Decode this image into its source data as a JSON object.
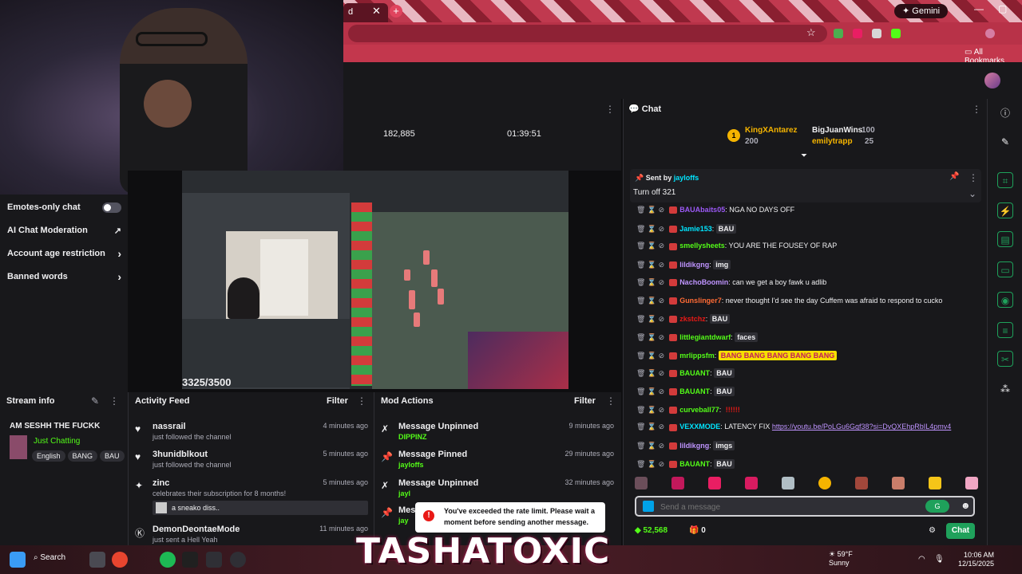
{
  "browser": {
    "tab_close": "✕",
    "new_tab": "+",
    "gemini_label": "Gemini",
    "all_bookmarks": "All Bookmarks"
  },
  "stats": {
    "viewers": "182,885",
    "uptime": "01:39:51"
  },
  "settings": {
    "items": [
      {
        "label": "Emotes-only chat",
        "control": "toggle"
      },
      {
        "label": "AI Chat Moderation",
        "control": "link"
      },
      {
        "label": "Account age restriction",
        "control": "arrow"
      },
      {
        "label": "Banned words",
        "control": "arrow"
      }
    ]
  },
  "video": {
    "counter": "3325/3500"
  },
  "stream_info": {
    "header": "Stream info",
    "title": "AM SESHH THE FUCKK",
    "category": "Just Chatting",
    "tags": [
      "English",
      "BANG",
      "BAU"
    ]
  },
  "activity_feed": {
    "header": "Activity Feed",
    "filter_label": "Filter",
    "items": [
      {
        "user": "nassrail",
        "text": "just followed the channel",
        "time": "4 minutes ago",
        "icon": "heart-icon"
      },
      {
        "user": "3hunidblkout",
        "text": "just followed the channel",
        "time": "5 minutes ago",
        "icon": "heart-icon"
      },
      {
        "user": "zinc",
        "text": "celebrates their subscription for 8 months!",
        "time": "5 minutes ago",
        "icon": "star-icon",
        "message": "a sneako diss.."
      },
      {
        "user": "DemonDeontaeMode",
        "text": "just sent a Hell Yeah",
        "time": "11 minutes ago",
        "icon": "kick-icon"
      }
    ]
  },
  "mod_actions": {
    "header": "Mod Actions",
    "filter_label": "Filter",
    "items": [
      {
        "action": "Message Unpinned",
        "by": "DIPPINZ",
        "time": "9 minutes ago"
      },
      {
        "action": "Message Pinned",
        "by": "jayloffs",
        "time": "29 minutes ago"
      },
      {
        "action": "Message Unpinned",
        "by": "jayl",
        "time": "32 minutes ago"
      },
      {
        "action": "Mes",
        "by": "jay",
        "time": ""
      }
    ]
  },
  "rate_limit": {
    "message": "You've exceeded the rate limit. Please wait a moment before sending another message."
  },
  "chat": {
    "header": "Chat",
    "leaderboard": [
      {
        "rank": "1",
        "user": "KingXAntarez",
        "amount": "200"
      },
      {
        "user": "BigJuanWins",
        "amount": "100"
      },
      {
        "user": "emilytrapp",
        "amount": "25"
      }
    ],
    "pinned": {
      "sent_by_label": "Sent by",
      "sent_by_user": "jayloffs",
      "text": "Turn off 321"
    },
    "messages": [
      {
        "user": "BAUAbaits05",
        "color": "#9b59f5",
        "text": "NGA NO DAYS OFF"
      },
      {
        "user": "Jamie153",
        "color": "#00e5ff",
        "text": "",
        "emote": "BAU"
      },
      {
        "user": "smellysheets",
        "color": "#53fc18",
        "text": "YOU ARE THE FOUSEY OF RAP"
      },
      {
        "user": "lildikgng",
        "color": "#bf94ff",
        "text": "",
        "emote": "img"
      },
      {
        "user": "NachoBoomin",
        "color": "#bf94ff",
        "text": "can we get a boy fawk u adlib"
      },
      {
        "user": "Gunslinger7",
        "color": "#ff6b35",
        "text": "never thought I'd see the day Cuffem was afraid to respond to cucko"
      },
      {
        "user": "zkstchz",
        "color": "#e91916",
        "text": "",
        "emote": "BAU"
      },
      {
        "user": "littlegiantdwarf",
        "color": "#53fc18",
        "text": "",
        "emote": "faces"
      },
      {
        "user": "mrlippsfm",
        "color": "#53fc18",
        "text": "",
        "emote": "BANG BANG BANG BANG BANG"
      },
      {
        "user": "BAUANT",
        "color": "#53fc18",
        "text": "",
        "emote": "BAU"
      },
      {
        "user": "BAUANT",
        "color": "#53fc18",
        "text": "",
        "emote": "BAU"
      },
      {
        "user": "curveball77",
        "color": "#53fc18",
        "text": "",
        "emote": "!!!!!!"
      },
      {
        "user": "VEXXMODE",
        "color": "#00e5ff",
        "text": "LATENCY FIX ",
        "link": "https://youtu.be/PoLGu6Ggf38?si=DvQXEhpRbIL4pmv4"
      },
      {
        "user": "lildikgng",
        "color": "#bf94ff",
        "text": "",
        "emote": "imgs"
      },
      {
        "user": "BAUANT",
        "color": "#53fc18",
        "text": "",
        "emote": "BAU"
      }
    ],
    "input_placeholder": "Send a message",
    "points": "52,568",
    "gift_count": "0",
    "send_label": "Chat"
  },
  "taskbar": {
    "search_label": "Search",
    "weather_temp": "59°F",
    "weather_desc": "Sunny",
    "time": "10:06 AM",
    "date": "12/15/2025"
  },
  "overlay_brand": "TASHATOXIC"
}
